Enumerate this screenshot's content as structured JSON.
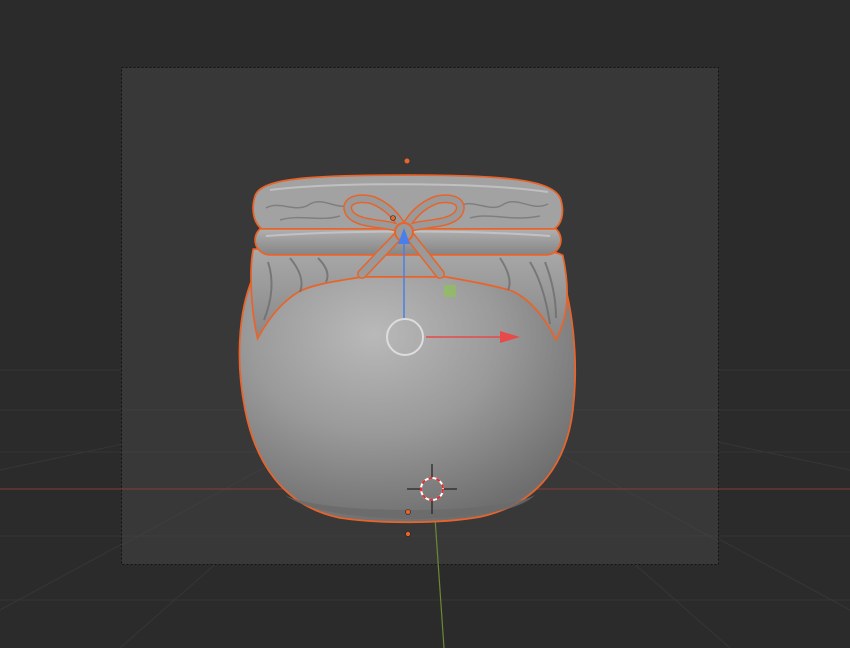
{
  "viewport": {
    "mode": "camera-view",
    "shading": "solid",
    "background_color": "#2b2b2b",
    "camera_frame_fill": "#383838",
    "camera_frame_border": "#111111",
    "grid_color": "#363636",
    "x_axis_color": "#8a3a3a",
    "y_axis_color": "#6a8a32"
  },
  "scene": {
    "selected_object": "pot",
    "object_color": "#8f8f8f",
    "selection_outline_color": "#e8642a"
  },
  "gizmo": {
    "type": "translate",
    "x_arrow_color": "#e84a4a",
    "z_arrow_color": "#4a7ee8",
    "plane_handle_color": "#8fbf5a",
    "center_circle_color": "#dddddd"
  },
  "cursor_3d": {
    "ring_color_a": "#ffffff",
    "ring_color_b": "#e03030"
  }
}
